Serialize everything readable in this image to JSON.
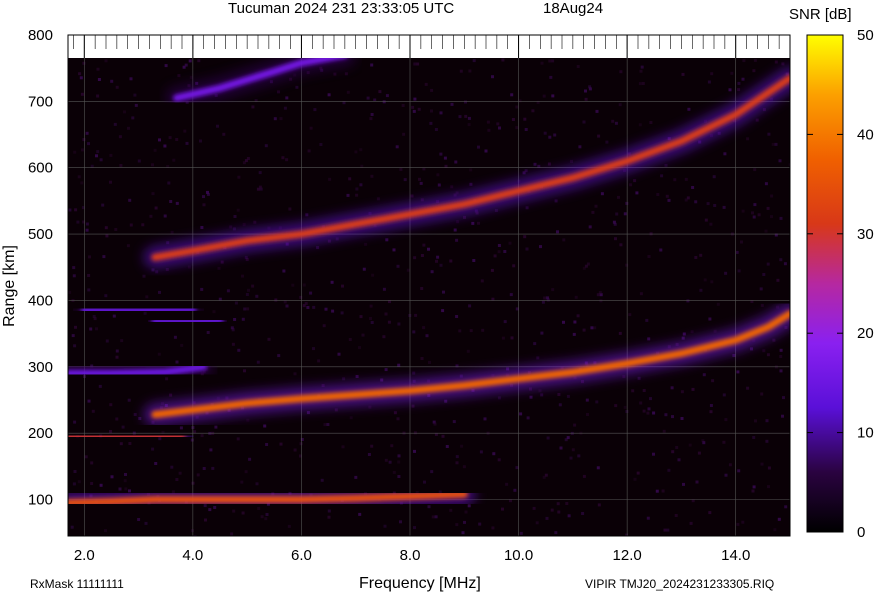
{
  "header": {
    "title": "Tucuman 2024 231 23:33:05 UTC",
    "date": "18Aug24"
  },
  "colorbar": {
    "label": "SNR [dB]",
    "ticks": [
      "0",
      "10",
      "20",
      "30",
      "40",
      "50"
    ]
  },
  "footer": {
    "rx_mask": "RxMask 11111111",
    "file": "VIPIR  TMJ20_2024231233305.RIQ"
  },
  "chart_data": {
    "type": "heatmap",
    "title": "Tucuman 2024 231 23:33:05 UTC",
    "xlabel": "Frequency [MHz]",
    "ylabel": "Range [km]",
    "xlim": [
      1.7,
      15.0
    ],
    "ylim": [
      45,
      800
    ],
    "x_ticks": [
      "2.0",
      "4.0",
      "6.0",
      "8.0",
      "10.0",
      "12.0",
      "14.0"
    ],
    "y_ticks": [
      "100",
      "200",
      "300",
      "400",
      "500",
      "600",
      "700",
      "800"
    ],
    "colorbar_label": "SNR [dB]",
    "colorbar_range": [
      0,
      50
    ],
    "grid": true,
    "traces": [
      {
        "x": [
          1.7,
          2.5,
          3.3,
          4.0,
          4.8,
          6.0,
          7.0,
          8.0,
          9.0
        ],
        "y": [
          95,
          97,
          100,
          100,
          100,
          100,
          102,
          105,
          108
        ],
        "snr": 35
      },
      {
        "x": [
          1.7,
          2.5,
          3.3,
          3.8
        ],
        "y": [
          195,
          195,
          195,
          196
        ],
        "snr": 30
      },
      {
        "x": [
          3.3,
          4.0,
          5.0,
          6.0,
          7.0,
          8.0,
          9.0,
          10.0,
          11.0,
          12.0,
          13.0,
          14.0,
          14.6,
          15.0
        ],
        "y": [
          228,
          235,
          245,
          252,
          258,
          264,
          272,
          282,
          292,
          305,
          320,
          340,
          360,
          380
        ],
        "snr": 38
      },
      {
        "x": [
          1.7,
          2.5,
          3.5,
          4.2
        ],
        "y": [
          290,
          290,
          292,
          300
        ],
        "snr": 15
      },
      {
        "x": [
          2.0,
          3.0,
          4.0
        ],
        "y": [
          385,
          385,
          387
        ],
        "snr": 14
      },
      {
        "x": [
          3.3,
          4.0,
          4.5
        ],
        "y": [
          368,
          368,
          370
        ],
        "snr": 14
      },
      {
        "x": [
          3.3,
          4.0,
          5.0,
          6.0,
          7.0,
          8.0,
          9.0,
          10.0,
          11.0,
          12.0,
          13.0,
          14.0,
          15.0
        ],
        "y": [
          465,
          475,
          490,
          500,
          515,
          530,
          545,
          565,
          585,
          610,
          640,
          680,
          735
        ],
        "snr": 32
      },
      {
        "x": [
          3.7,
          4.5,
          5.5,
          6.0,
          6.8
        ],
        "y": [
          705,
          720,
          745,
          758,
          770
        ],
        "snr": 16
      }
    ]
  }
}
